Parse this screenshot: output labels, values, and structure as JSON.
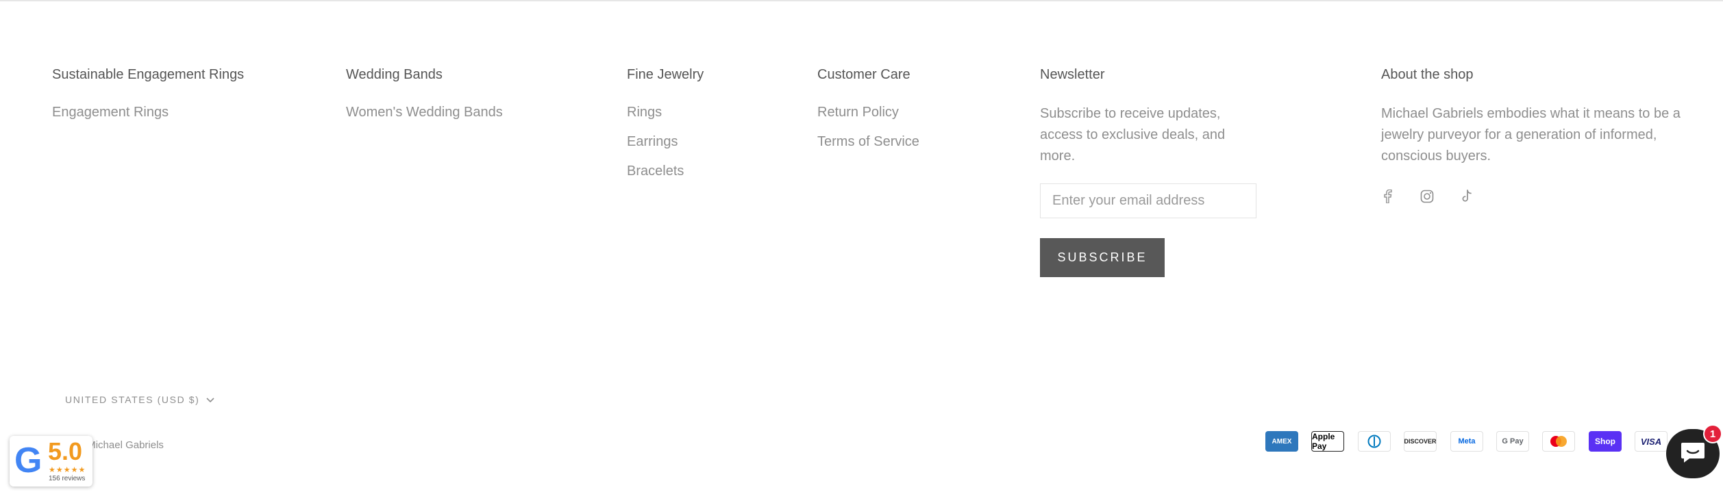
{
  "footer": {
    "columns": [
      {
        "title": "Sustainable Engagement Rings",
        "links": [
          "Engagement Rings"
        ]
      },
      {
        "title": "Wedding Bands",
        "links": [
          "Women's Wedding Bands"
        ]
      },
      {
        "title": "Fine Jewelry",
        "links": [
          "Rings",
          "Earrings",
          "Bracelets"
        ]
      },
      {
        "title": "Customer Care",
        "links": [
          "Return Policy",
          "Terms of Service"
        ]
      }
    ],
    "newsletter": {
      "title": "Newsletter",
      "text": "Subscribe to receive updates, access to exclusive deals, and more.",
      "email_placeholder": "Enter your email address",
      "button_label": "SUBSCRIBE"
    },
    "about": {
      "title": "About the shop",
      "text": "Michael Gabriels embodies what it means to be a jewelry purveyor for a generation of informed, conscious buyers.",
      "social_icons": [
        "facebook-icon",
        "instagram-icon",
        "tiktok-icon"
      ]
    },
    "country_selector": "UNITED STATES (USD $)",
    "copyright": "© Michael Gabriels",
    "payment_methods": [
      "AMEX",
      "Apple Pay",
      "Diners",
      "DISCOVER",
      "Meta",
      "G Pay",
      "Mastercard",
      "Shop",
      "VISA"
    ]
  },
  "google_badge": {
    "letter": "G",
    "score": "5.0",
    "stars": "★★★★★",
    "reviews": "156 reviews"
  },
  "chat_widget": {
    "badge_count": "1",
    "icon": "chat-bubble-icon"
  },
  "colors": {
    "button_bg": "#585858",
    "google_blue": "#4285F4",
    "star_orange": "#f29a1f",
    "chat_bg": "#222222",
    "badge_red": "#e3203a"
  }
}
